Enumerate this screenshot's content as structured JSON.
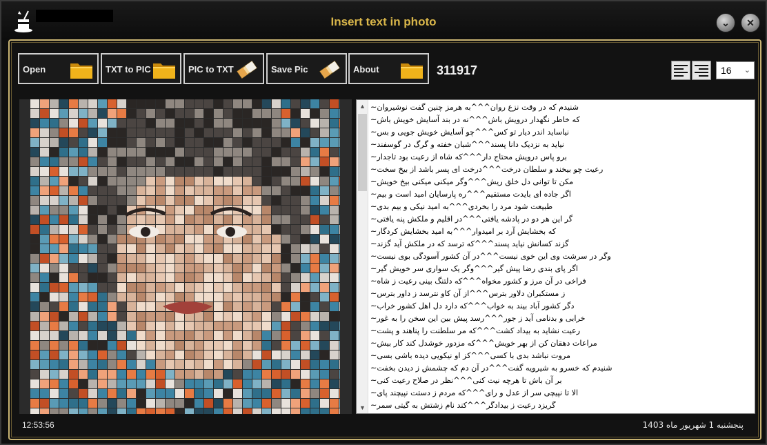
{
  "window": {
    "title": "Insert text in photo"
  },
  "title_buttons": {
    "minimize_icon": "chevron-down-icon",
    "close_icon": "close-icon"
  },
  "toolbar": {
    "open_label": "Open",
    "txt_to_pic_label": "TXT to PIC",
    "pic_to_txt_label": "PIC to TXT",
    "save_pic_label": "Save Pic",
    "about_label": "About"
  },
  "counter": "311917",
  "font_size": {
    "selected": "16"
  },
  "text_content": [
    "شنیدم که در وقت نزع روان^^^به هرمز چنین گفت نوشیروان~",
    "که خاطر نگهدار درویش باش^^^نه در بند آسایش خویش باش~",
    "نیاساید اندر دیار تو کس^^^چو آسایش خویش جویی و بس~",
    "نیاید به نزدیک دانا پسند^^^شبان خفته و گرگ در گوسفند~",
    "برو پاس درویش محتاج دار^^^که شاه از رعیت بود تاجدار~",
    "رعیت چو بیخند و سلطان درخت^^^درخت ای پسر باشد از بیخ سخت~",
    "مکن تا توانی دل خلق ریش^^^وگر میکنی میکنی بیخ خویش~",
    "اگر جاده ای بایدت مستقیم^^^ره پارسایان امید است و بیم~",
    "طبیعت شود مرد را بخردی^^^به امید نیکی و بیم بدی~",
    "گر این هر دو در پادشه یافتی^^^در اقلیم و  ملکش پنه یافتی~",
    "که بخشایش آرد بر امیدوار^^^به امید بخشایش کردگار~",
    "گزند کسانش نیاید پسند^^^که ترسد که در ملکش آید گزند~",
    "وگر در سرشت وی این خوی نیست^^^در آن کشور آسودگی بوی نیست~",
    "اگر پای بندی رضا پیش گیر^^^وگر یک سواری سر خویش گیر~",
    "فراخی در آن مرز و کشور مخواه^^^که دلتنگ بینی رعیت ز شاه~",
    "ز مستکبران دلاور بترس^^^از آن کاو نترسد ز داور بترس~",
    "دگر کشور آباد بیند به خواب^^^که دارد دل اهل کشور خراب~",
    "خرابی و بدنامی آید ز جور^^^رسد پیش بین این سخن را به غور~",
    "رعیت نشاید به بیداد کشت^^^که مر سلطنت را پناهند و پشت~",
    "مراعات دهقان کن از بهر خویش^^^که مزدور خوشدل کند کار بیش~",
    "مروت نباشد بدی با کسی^^^کز او نیکویی دیده باشی بسی~",
    "شنیدم که خسرو به شیرویه گفت^^^در آن دم که چشمش ز دیدن بخفت~",
    "بر آن باش تا هرچه نیت کنی^^^نظر در صلاح رعیت کنی~",
    "الا تا نپیچی سر از عدل و رای^^^که مردم ز دستت نپیچند پای~",
    "گریزد رعیت ز بیدادگر^^^کند نام زشتش به گیتی سمر~"
  ],
  "status": {
    "time": "12:53:56",
    "date": "پنجشنبه 1 شهریور ماه 1403"
  },
  "colors": {
    "title_gold": "#d9b64a",
    "frame_gold": "#c9b473",
    "background": "#121212"
  },
  "icons": {
    "app": "magic-hat-icon",
    "open": "folder-icon",
    "txt_to_pic": "folder-icon",
    "pic_to_txt": "eraser-icon",
    "save_pic": "eraser-icon",
    "about": "folder-icon",
    "align_left": "align-left-icon",
    "align_right": "align-right-icon"
  }
}
